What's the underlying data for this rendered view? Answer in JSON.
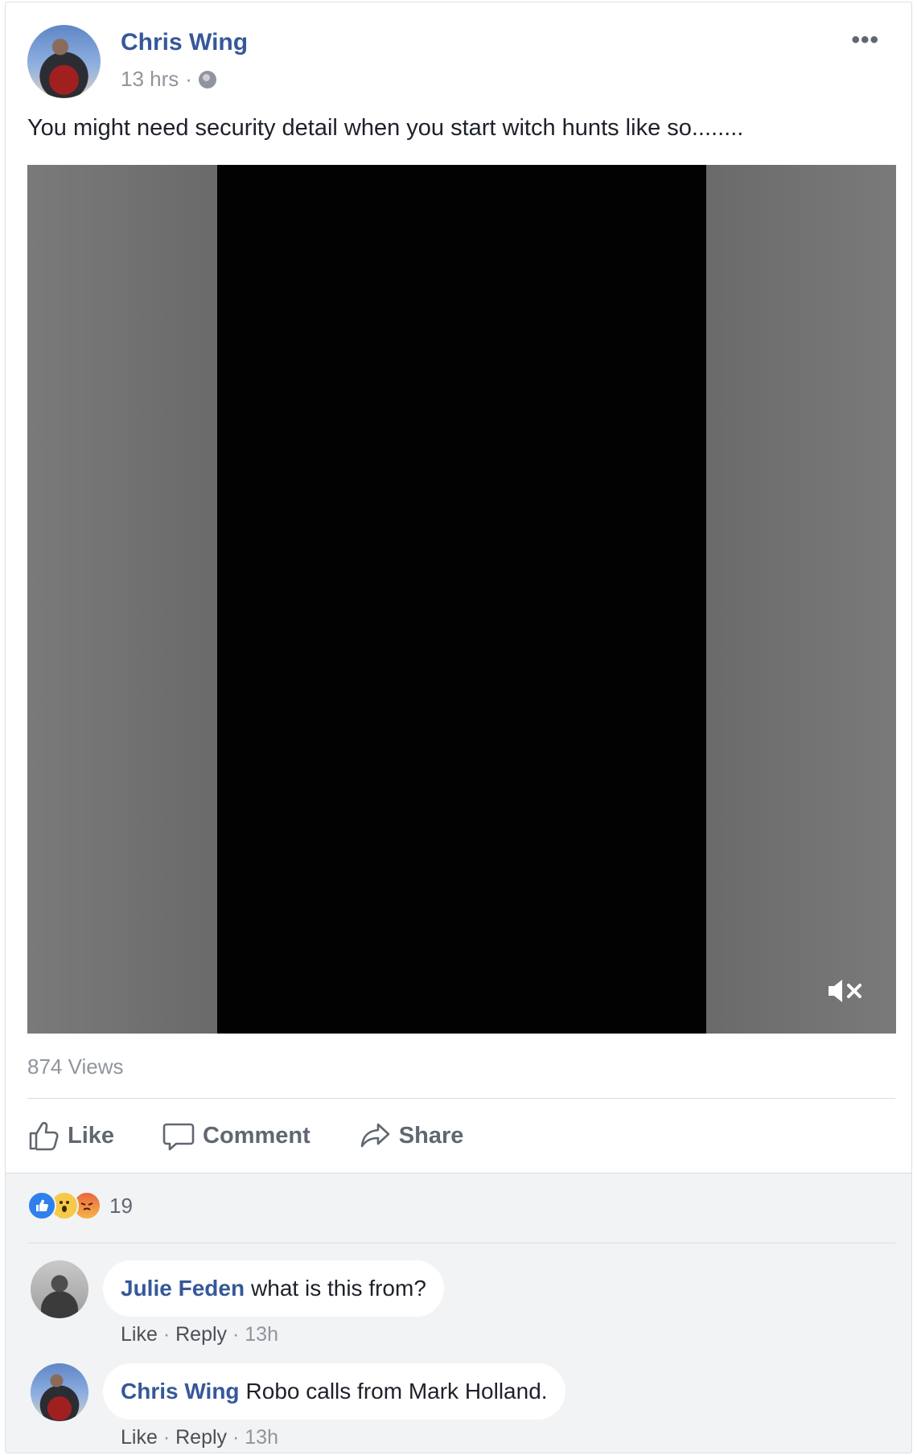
{
  "post": {
    "author": "Chris Wing",
    "time": "13 hrs",
    "time_sep": "·",
    "more": "•••",
    "text": "You might need security detail when you start witch hunts like so........",
    "views": "874 Views",
    "actions": {
      "like": "Like",
      "comment": "Comment",
      "share": "Share"
    }
  },
  "reactions": {
    "types": [
      "like-reaction",
      "wow-reaction",
      "angry-reaction"
    ],
    "count": "19"
  },
  "comments": [
    {
      "author": "Julie Feden",
      "text": "what is this from?",
      "like": "Like",
      "reply": "Reply",
      "sep": "·",
      "time": "13h"
    },
    {
      "author": "Chris Wing",
      "text": "Robo calls from Mark Holland.",
      "like": "Like",
      "reply": "Reply",
      "sep": "·",
      "time": "13h"
    }
  ],
  "colors": {
    "link_blue": "#365899",
    "meta_grey": "#90949c",
    "action_grey": "#606770",
    "comment_bg": "#f2f3f5"
  }
}
